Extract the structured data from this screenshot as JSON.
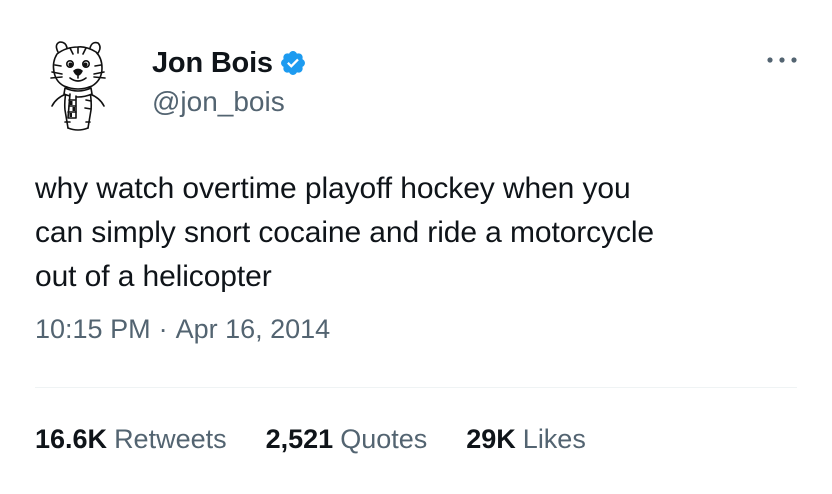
{
  "author": {
    "display_name": "Jon Bois",
    "handle": "@jon_bois",
    "verified": true,
    "avatar_icon": "calvin-and-hobbes-tiger-avatar",
    "verified_icon": "verified-badge-icon"
  },
  "tweet": {
    "text": "why watch overtime playoff hockey when you\ncan simply snort cocaine and ride a motorcycle\nout of a helicopter",
    "time": "10:15 PM",
    "separator": "·",
    "date": "Apr 16, 2014"
  },
  "stats": [
    {
      "value": "16.6K",
      "label": "Retweets"
    },
    {
      "value": "2,521",
      "label": "Quotes"
    },
    {
      "value": "29K",
      "label": "Likes"
    }
  ],
  "colors": {
    "text": "#0f1419",
    "secondary": "#536471",
    "verified": "#1d9bf0",
    "divider": "#eff3f4"
  }
}
